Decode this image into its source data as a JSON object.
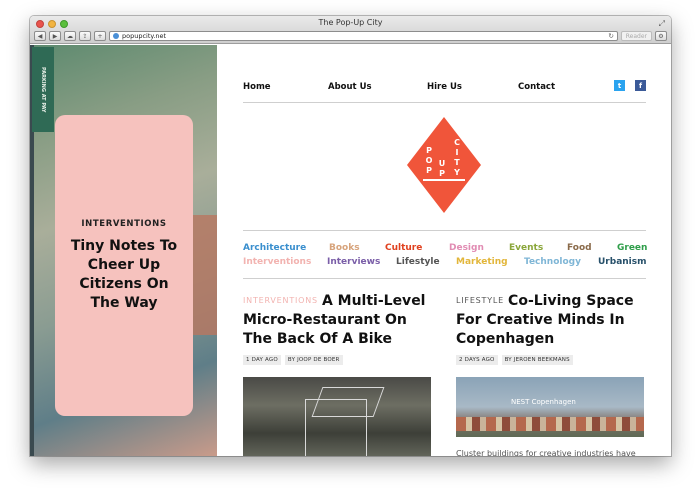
{
  "window": {
    "title": "The Pop-Up City",
    "url": "popupcity.net",
    "reader_label": "Reader"
  },
  "feature": {
    "category": "INTERVENTIONS",
    "title": "Tiny Notes To Cheer Up Citizens On The Way",
    "sign_text": "PARKING AT PAY"
  },
  "nav": {
    "items": [
      "Home",
      "About Us",
      "Hire Us",
      "Contact"
    ],
    "twitter_glyph": "t",
    "facebook_glyph": "f"
  },
  "logo": {
    "letters": [
      "P",
      "O",
      "P",
      "U",
      "P",
      "C",
      "I",
      "T",
      "Y"
    ],
    "color": "#f0553a"
  },
  "categories": [
    {
      "label": "Architecture",
      "color": "#3a8fce"
    },
    {
      "label": "Books",
      "color": "#d7a37b"
    },
    {
      "label": "Culture",
      "color": "#e0411f"
    },
    {
      "label": "Design",
      "color": "#e18cb3"
    },
    {
      "label": "Events",
      "color": "#8aa63a"
    },
    {
      "label": "Food",
      "color": "#8a6a4a"
    },
    {
      "label": "Green",
      "color": "#2f9e4a"
    },
    {
      "label": "Interventions",
      "color": "#f2b3b0"
    },
    {
      "label": "Interviews",
      "color": "#7a5ea8"
    },
    {
      "label": "Lifestyle",
      "color": "#555555"
    },
    {
      "label": "Marketing",
      "color": "#e2b63a"
    },
    {
      "label": "Technology",
      "color": "#7fb6d6"
    },
    {
      "label": "Urbanism",
      "color": "#27506a"
    }
  ],
  "posts": [
    {
      "category": "INTERVENTIONS",
      "category_color": "#f2b3b0",
      "title": "A Multi-Level Micro-Restaurant On The Back Of A Bike",
      "time": "1 DAY AGO",
      "author": "BY JOOP DE BOER"
    },
    {
      "category": "LIFESTYLE",
      "category_color": "#555555",
      "title": "Co-Living Space For Creative Minds In Copenhagen",
      "time": "2 DAYS AGO",
      "author": "BY JEROEN BEEKMANS",
      "image_label": "NEST Copenhagen",
      "excerpt": "Cluster buildings for creative industries have become totally normal in our cities. Six"
    }
  ]
}
